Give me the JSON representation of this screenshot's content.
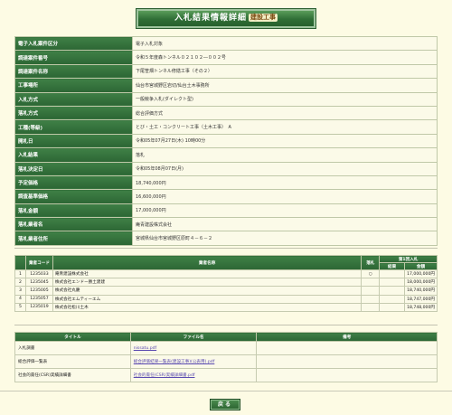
{
  "header": {
    "title": "入札結果情報詳細",
    "tag": "建設工事"
  },
  "details": [
    {
      "label": "電子入札案件区分",
      "value": "電子入札対象"
    },
    {
      "label": "調達案件番号",
      "value": "令和５年度森トンネル０２１０２―００２号"
    },
    {
      "label": "調達案件名称",
      "value": "下尾笹畑トンネル修繕工事（その２）"
    },
    {
      "label": "工事場所",
      "value": "仙台市宮城野区岩切/仙台土木事務所"
    },
    {
      "label": "入札方式",
      "value": "一般競争入札(ダイレクト型)"
    },
    {
      "label": "落札方式",
      "value": "総合評価方式"
    },
    {
      "label": "工種(等級)",
      "value": "とび・土工・コンクリート工事（土木工事）　A"
    },
    {
      "label": "開札日",
      "value": "令和05年07月27日(木) 10時00分"
    },
    {
      "label": "入札結果",
      "value": "落札"
    },
    {
      "label": "落札決定日",
      "value": "令和05年08月07日(月)"
    },
    {
      "label": "予定価格",
      "value": "18,740,000円"
    },
    {
      "label": "調査基準価格",
      "value": "16,600,000円"
    },
    {
      "label": "落札金額",
      "value": "17,000,000円"
    },
    {
      "label": "落札業者名",
      "value": "庵青建設株式会社"
    },
    {
      "label": "落札業者住所",
      "value": "宮城県仙台市宮城野区原町４－６－２"
    }
  ],
  "bidders": {
    "headers": {
      "no": "",
      "code": "業者コード",
      "name": "業者名称",
      "award": "落札",
      "bid_group": "第1回入札",
      "amount": "結果",
      "amount2": "金額"
    },
    "rows": [
      {
        "no": "1",
        "code": "1235033",
        "name": "庵青建設株式会社",
        "award": "○",
        "result": "",
        "amount": "17,000,000円"
      },
      {
        "no": "2",
        "code": "1235045",
        "name": "株式会社エンドー勝土建建",
        "award": "",
        "result": "",
        "amount": "18,000,000円"
      },
      {
        "no": "3",
        "code": "1235005",
        "name": "株式会社丸慶",
        "award": "",
        "result": "",
        "amount": "18,740,000円"
      },
      {
        "no": "4",
        "code": "1235057",
        "name": "株式会社エムティーエム",
        "award": "",
        "result": "",
        "amount": "18,747,000円"
      },
      {
        "no": "5",
        "code": "1235019",
        "name": "株式会社松川土木",
        "award": "",
        "result": "",
        "amount": "18,748,000円"
      }
    ]
  },
  "files": {
    "headers": {
      "title": "タイトル",
      "filename": "ファイル名",
      "note": "備考"
    },
    "rows": [
      {
        "title": "入札調書",
        "filename": "nissatu.pdf",
        "note": ""
      },
      {
        "title": "総合評価一覧表",
        "filename": "総合評価結果一覧表(建設工事)(公表用).pdf",
        "note": ""
      },
      {
        "title": "社会的責任(CSR)実績詳細書",
        "filename": "社会的責任(CSR)実績詳細書.pdf",
        "note": ""
      }
    ]
  },
  "footer": {
    "back_label": "戻る"
  }
}
